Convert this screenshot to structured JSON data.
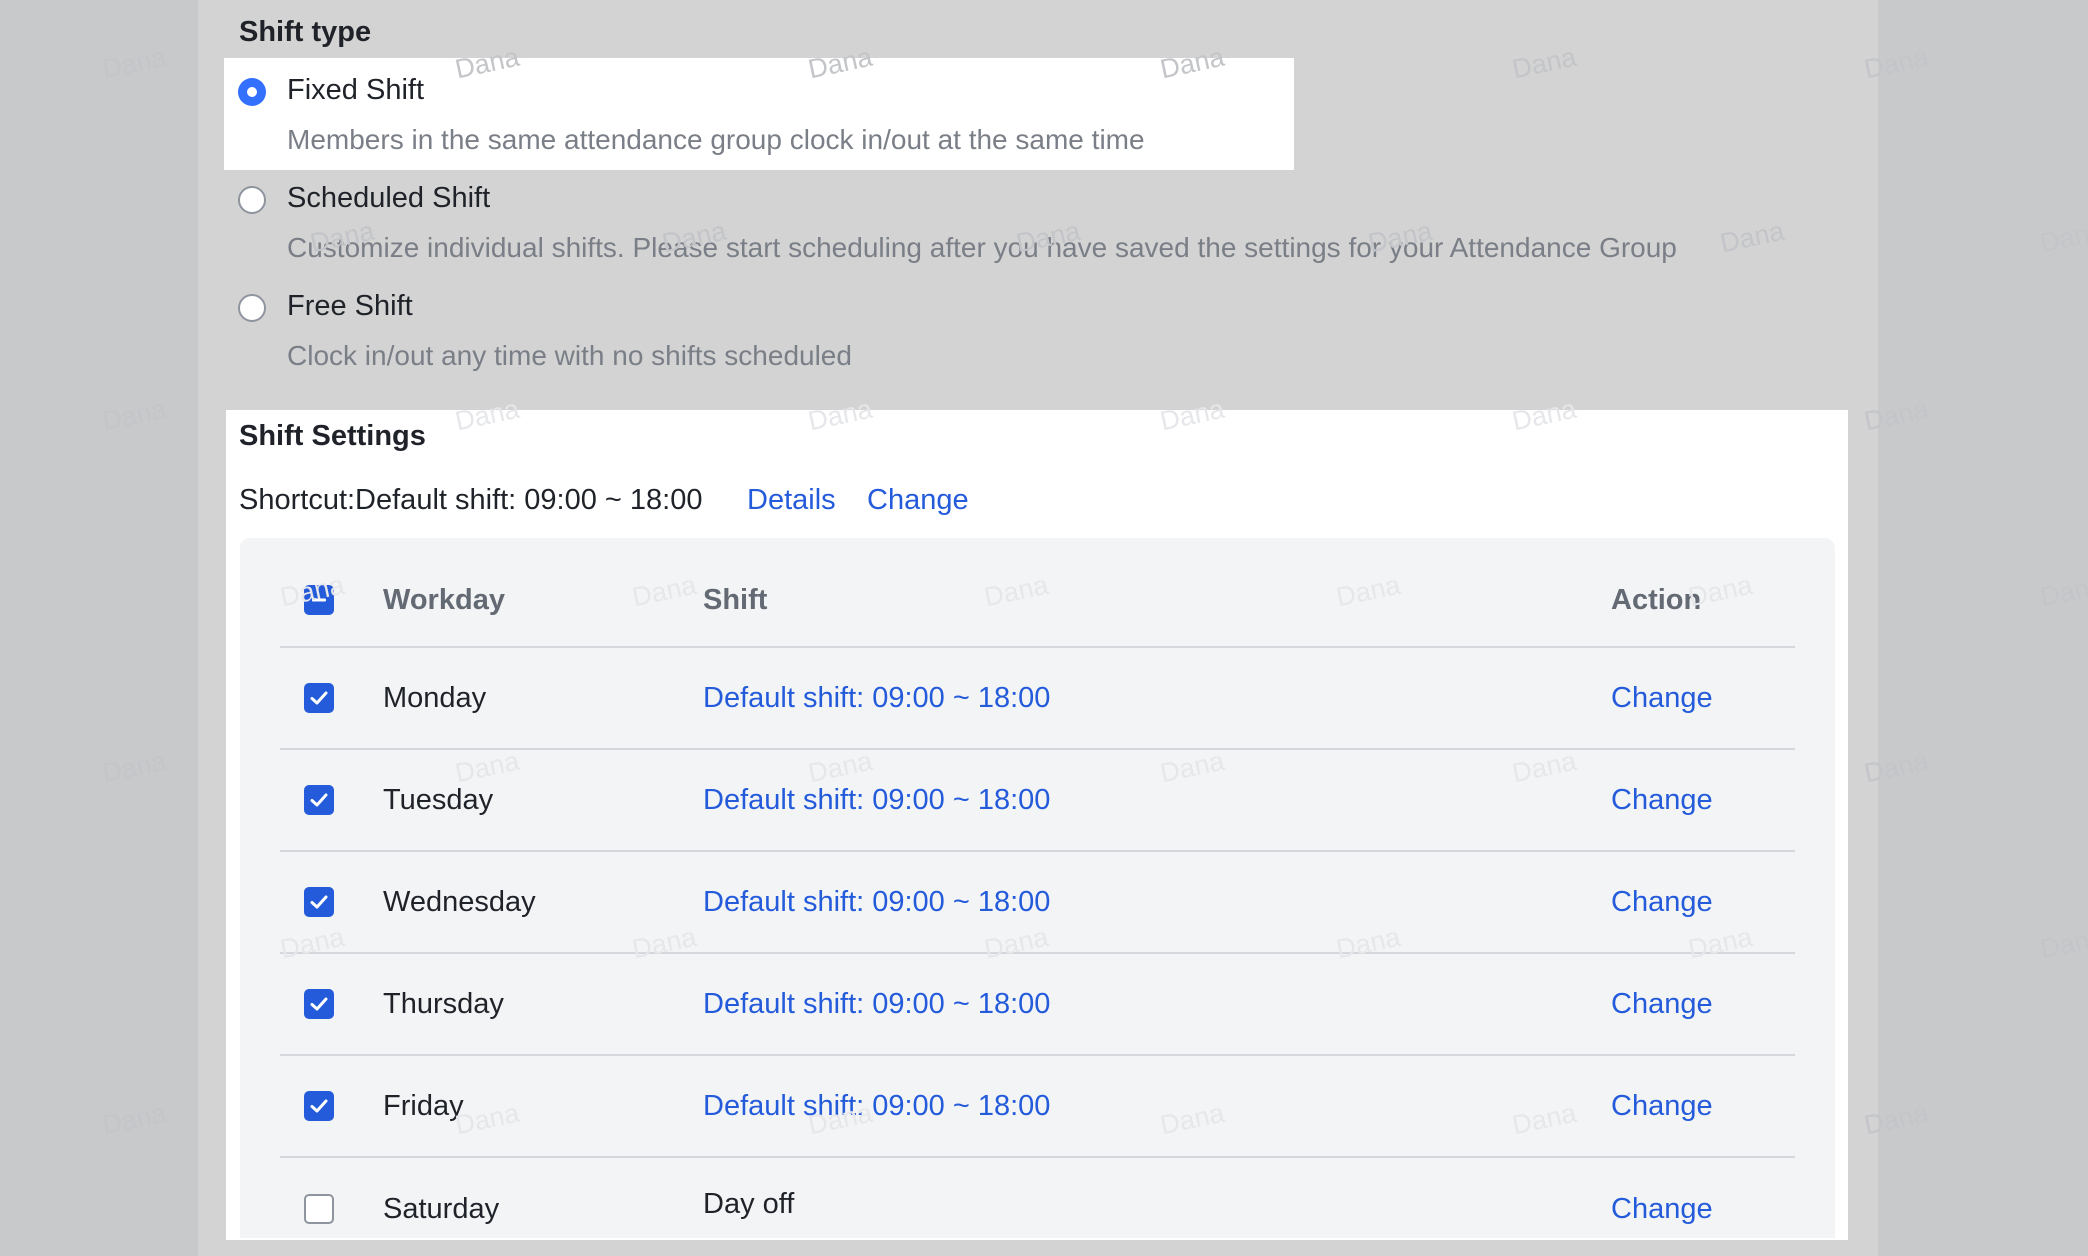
{
  "shift_type": {
    "title": "Shift type",
    "options": [
      {
        "label": "Fixed Shift",
        "description": "Members in the same attendance group clock in/out at the same time",
        "selected": true
      },
      {
        "label": "Scheduled Shift",
        "description": "Customize individual shifts. Please start scheduling after you have saved the settings for your Attendance Group",
        "selected": false
      },
      {
        "label": "Free Shift",
        "description": "Clock in/out any time with no shifts scheduled",
        "selected": false
      }
    ]
  },
  "shift_settings": {
    "title": "Shift Settings",
    "shortcut_text": "Shortcut:Default shift: 09:00 ~ 18:00",
    "details_link": "Details",
    "change_link": "Change"
  },
  "table": {
    "headers": {
      "workday": "Workday",
      "shift": "Shift",
      "action": "Action"
    },
    "rows": [
      {
        "day": "Monday",
        "shift": "Default shift: 09:00 ~ 18:00",
        "action": "Change",
        "checked": true
      },
      {
        "day": "Tuesday",
        "shift": "Default shift: 09:00 ~ 18:00",
        "action": "Change",
        "checked": true
      },
      {
        "day": "Wednesday",
        "shift": "Default shift: 09:00 ~ 18:00",
        "action": "Change",
        "checked": true
      },
      {
        "day": "Thursday",
        "shift": "Default shift: 09:00 ~ 18:00",
        "action": "Change",
        "checked": true
      },
      {
        "day": "Friday",
        "shift": "Default shift: 09:00 ~ 18:00",
        "action": "Change",
        "checked": true
      },
      {
        "day": "Saturday",
        "shift": "Day off",
        "action": "Change",
        "checked": false
      }
    ]
  },
  "watermark": "Dana",
  "colors": {
    "accent": "#245bdb",
    "radio_selected": "#3370ff",
    "muted_text": "#7a7f87",
    "overlay": "#d3d3d3"
  }
}
